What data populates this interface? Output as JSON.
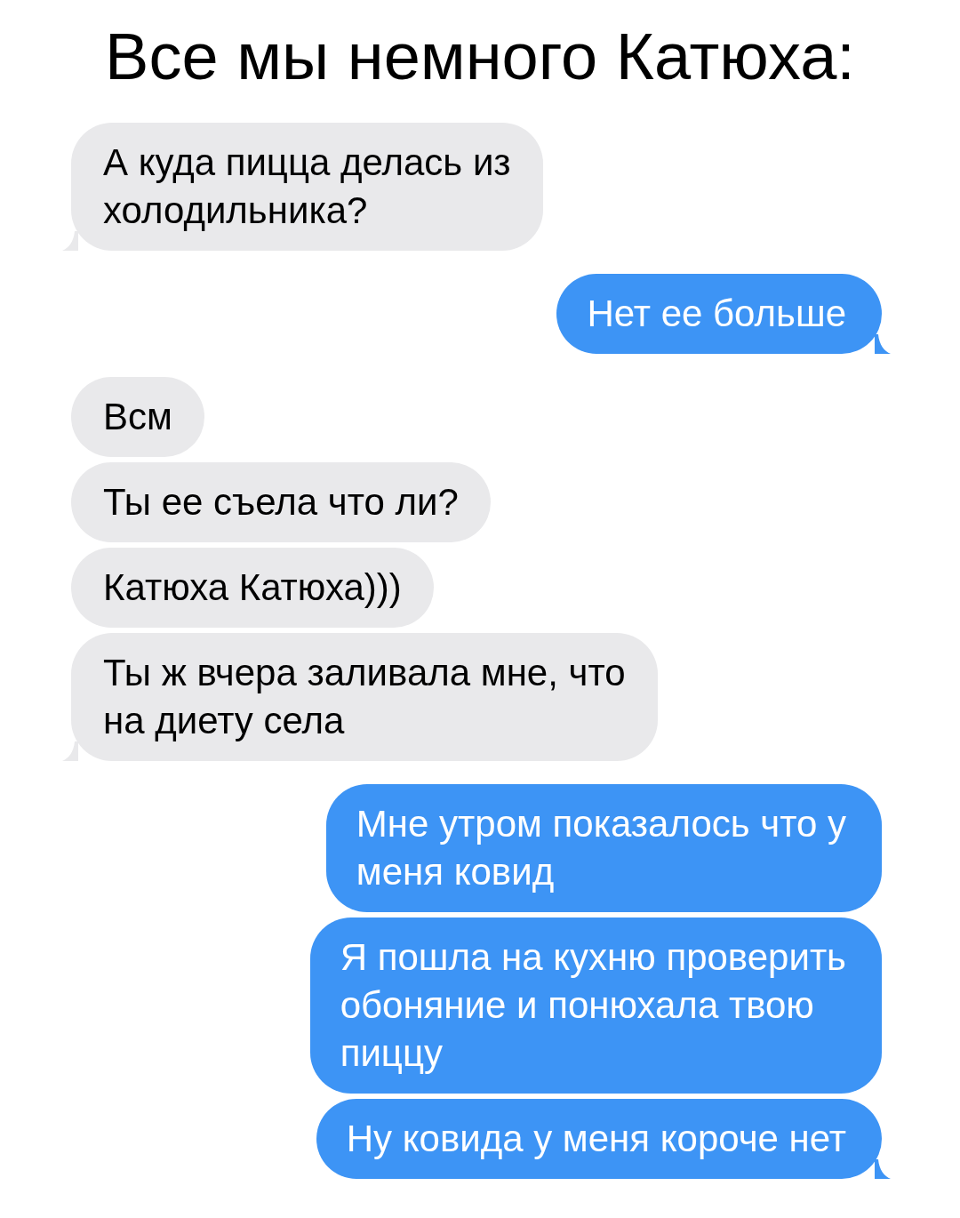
{
  "title": "Все мы немного Катюха:",
  "messages": [
    {
      "lines": [
        "А куда пицца делась из",
        "холодильника?"
      ],
      "kind": "received",
      "tail": true
    },
    {
      "lines": [
        "Нет ее больше"
      ],
      "kind": "sent",
      "tail": true
    },
    {
      "lines": [
        "Всм"
      ],
      "kind": "received",
      "tail": false
    },
    {
      "lines": [
        "Ты ее съела что ли?"
      ],
      "kind": "received",
      "tail": false
    },
    {
      "lines": [
        "Катюха Катюха)))"
      ],
      "kind": "received",
      "tail": false
    },
    {
      "lines": [
        "Ты ж вчера заливала мне, что",
        "на диету села"
      ],
      "kind": "received",
      "tail": true
    },
    {
      "lines": [
        "Мне утром показалось что у",
        "меня ковид"
      ],
      "kind": "sent",
      "tail": false
    },
    {
      "lines": [
        "Я пошла на кухню проверить",
        "обоняние и понюхала твою",
        "пиццу"
      ],
      "kind": "sent",
      "tail": false
    },
    {
      "lines": [
        "Ну ковида у меня короче нет"
      ],
      "kind": "sent",
      "tail": true
    }
  ]
}
